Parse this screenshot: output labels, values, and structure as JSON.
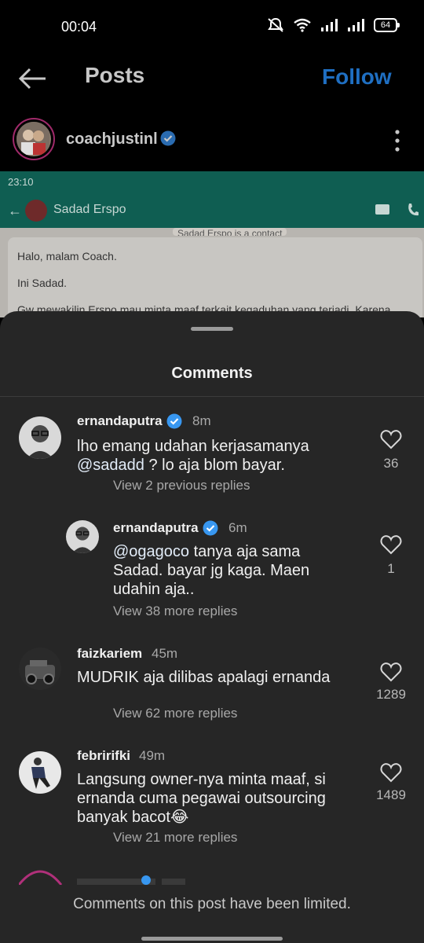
{
  "status_bar": {
    "time": "00:04",
    "battery": "64"
  },
  "header": {
    "title": "Posts",
    "follow_label": "Follow"
  },
  "author": {
    "username": "coachjustinl"
  },
  "screenshot": {
    "time": "23:10",
    "contact": "Sadad Erspo",
    "system_note": "Sadad Erspo is a contact",
    "lines": [
      "Halo, malam Coach.",
      "Ini Sadad.",
      "Gw mewakilin Erspo mau minta maaf terkait kegaduhan yang terjadi. Karena"
    ]
  },
  "sheet": {
    "title": "Comments"
  },
  "comments": [
    {
      "username": "ernandaputra",
      "time": "8m",
      "text_pre": "lho emang udahan kerjasamanya",
      "mention": "@sadadd",
      "text_post": " ? lo aja blom bayar.",
      "replies": "View 2 previous replies",
      "likes": "36"
    },
    {
      "username": "ernandaputra",
      "time": "6m",
      "mention": "@ogagoco",
      "text_post": " tanya aja sama Sadad. bayar jg kaga. Maen udahin aja..",
      "replies": "View 38 more replies",
      "likes": "1"
    },
    {
      "username": "faizkariem",
      "time": "45m",
      "text": "MUDRIK aja dilibas apalagi ernanda",
      "replies": "View 62 more replies",
      "likes": "1289"
    },
    {
      "username": "febririfki",
      "time": "49m",
      "text": "Langsung owner-nya minta maaf, si ernanda cuma pegawai outsourcing banyak bacot😂",
      "replies": "View 21 more replies",
      "likes": "1489"
    }
  ],
  "footer": {
    "limited": "Comments on this post have been limited."
  },
  "colors": {
    "verified": "#3897f0",
    "follow": "#1f6fc2",
    "sheet_bg": "#262626"
  }
}
